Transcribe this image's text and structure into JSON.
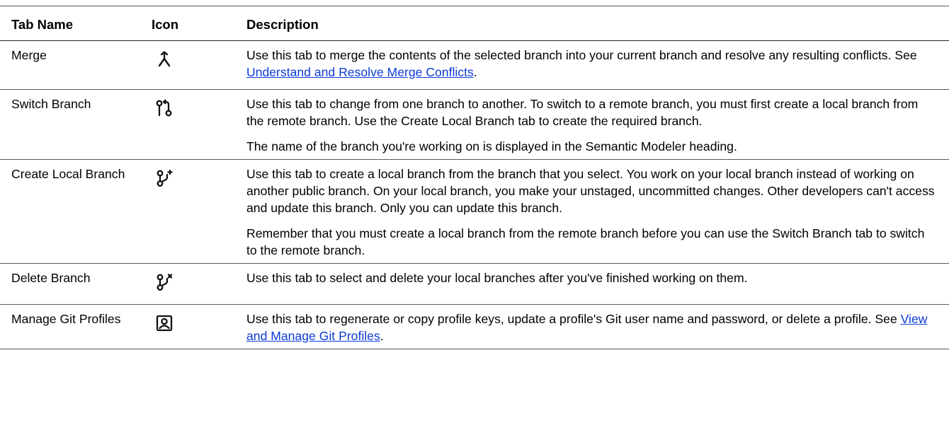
{
  "headers": {
    "tab_name": "Tab Name",
    "icon": "Icon",
    "description": "Description"
  },
  "rows": [
    {
      "name": "Merge",
      "icon": "merge-icon",
      "paragraphs": [
        {
          "text": "Use this tab to merge the contents of the selected branch into your current branch and resolve any resulting conflicts. See ",
          "link": "Understand and Resolve Merge Conflicts",
          "after": "."
        }
      ]
    },
    {
      "name": "Switch Branch",
      "icon": "switch-branch-icon",
      "paragraphs": [
        {
          "text": "Use this tab to change from one branch to another. To switch to a remote branch, you must first create a local branch from the remote branch. Use the Create Local Branch tab to create the required branch."
        },
        {
          "text": "The name of the branch you're working on is displayed in the Semantic Modeler heading."
        }
      ]
    },
    {
      "name": "Create Local Branch",
      "icon": "create-local-branch-icon",
      "paragraphs": [
        {
          "text": "Use this tab to create a local branch from the branch that you select. You work on your local branch instead of working on another public branch. On your local branch, you make your unstaged, uncommitted changes. Other developers can't access and update this branch. Only you can update this branch."
        },
        {
          "text": "Remember that you must create a local branch from the remote branch before you can use the Switch Branch tab to switch to the remote branch."
        }
      ]
    },
    {
      "name": "Delete Branch",
      "icon": "delete-branch-icon",
      "paragraphs": [
        {
          "text": "Use this tab to select and delete your local branches after you've finished working on them."
        }
      ]
    },
    {
      "name": "Manage Git Profiles",
      "icon": "profile-icon",
      "paragraphs": [
        {
          "text": "Use this tab to regenerate or copy profile keys, update a profile's Git user name and password, or delete a profile. See ",
          "link": "View and Manage Git Profiles",
          "after": "."
        }
      ]
    }
  ]
}
